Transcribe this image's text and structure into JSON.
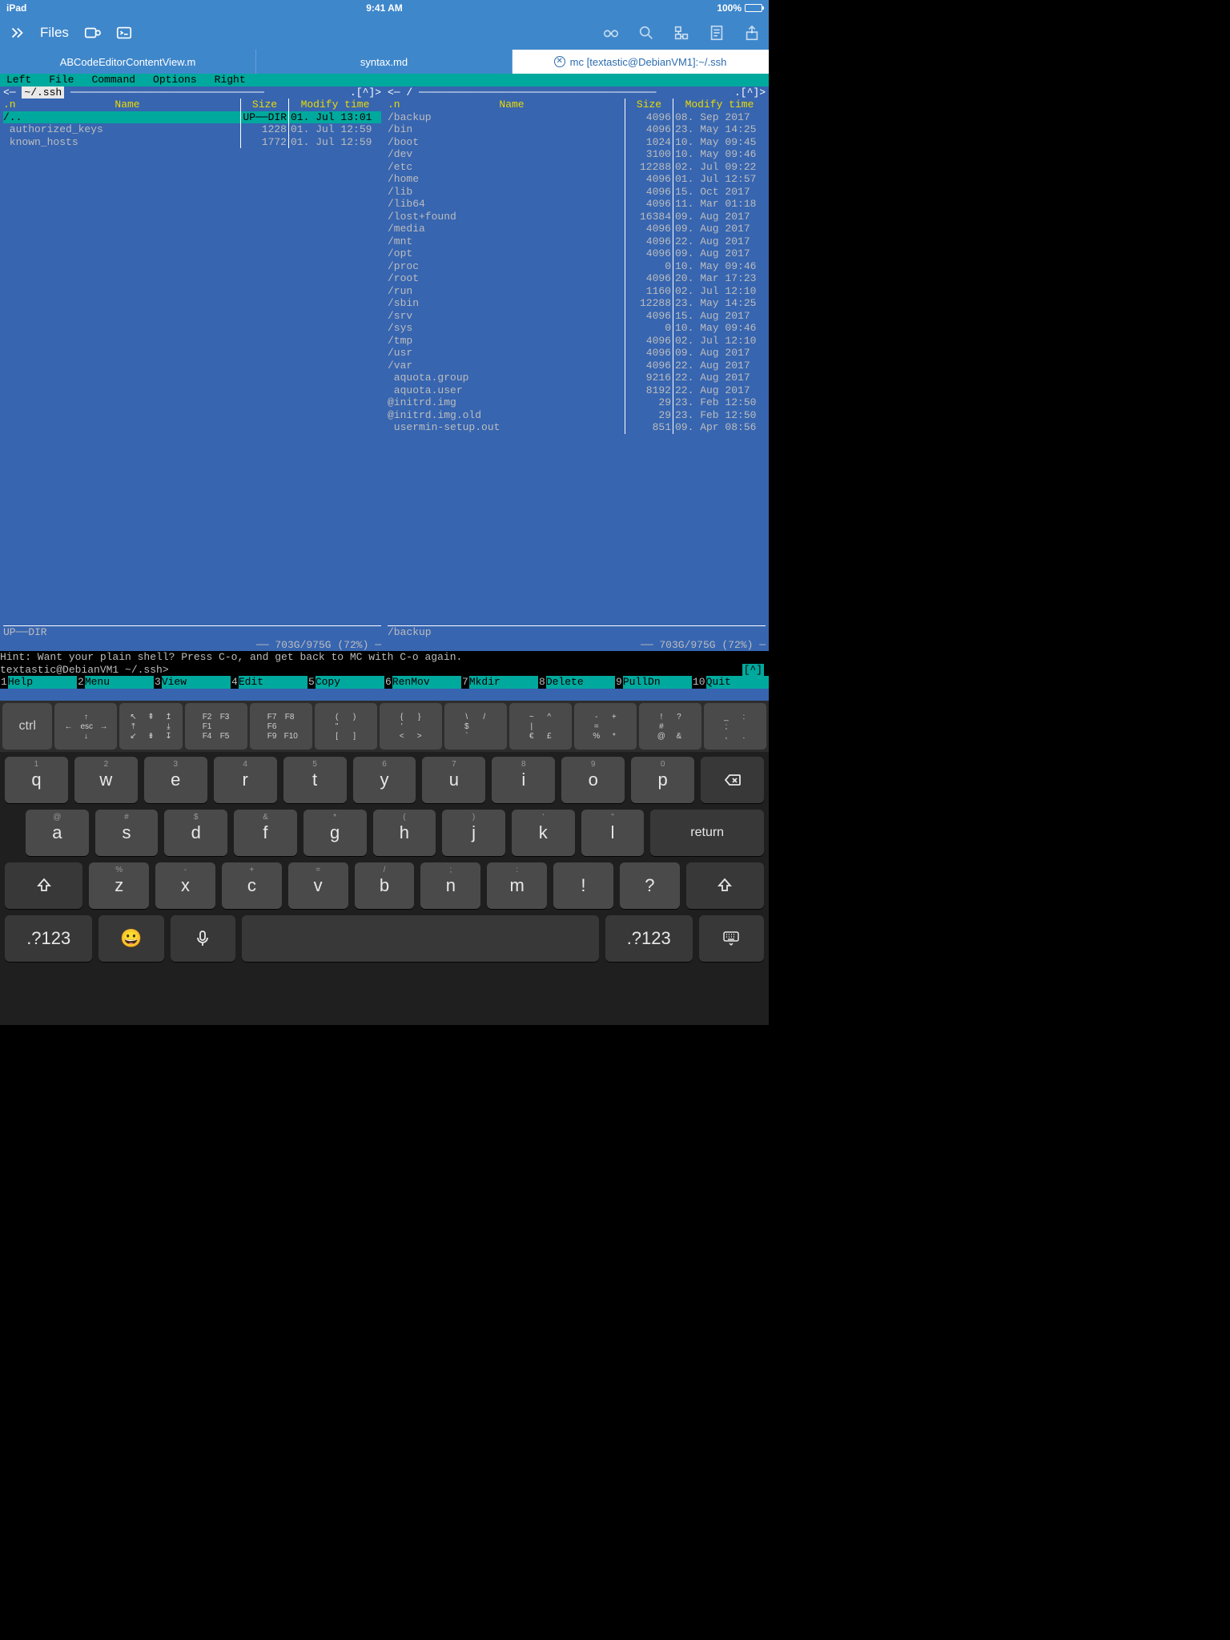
{
  "status": {
    "device": "iPad",
    "time": "9:41 AM",
    "battery": "100%"
  },
  "toolbar": {
    "title": "Files"
  },
  "tabs": [
    {
      "label": "ABCodeEditorContentView.m",
      "active": false
    },
    {
      "label": "syntax.md",
      "active": false
    },
    {
      "label": "mc [textastic@DebianVM1]:~/.ssh",
      "active": true
    }
  ],
  "mc": {
    "menu": [
      "Left",
      "File",
      "Command",
      "Options",
      "Right"
    ],
    "left": {
      "path": "~/.ssh",
      "path_prefix": "<─ ",
      "hdr_tail": " .[^]>",
      "cols": {
        "n": ".n",
        "name": "Name",
        "size": "Size",
        "mtime": "Modify time"
      },
      "rows": [
        {
          "name": "/..",
          "size": "UP──DIR",
          "mtime": "01. Jul 13:01",
          "sel": true
        },
        {
          "name": " authorized_keys",
          "size": "1228",
          "mtime": "01. Jul 12:59"
        },
        {
          "name": " known_hosts",
          "size": "1772",
          "mtime": "01. Jul 12:59"
        }
      ],
      "footer1": "UP──DIR",
      "footer2": "── 703G/975G (72%) ─"
    },
    "right": {
      "path": "/",
      "path_prefix": "<─ ",
      "hdr_tail": " .[^]>",
      "cols": {
        "n": ".n",
        "name": "Name",
        "size": "Size",
        "mtime": "Modify time"
      },
      "rows": [
        {
          "name": "/backup",
          "size": "4096",
          "mtime": "08. Sep 2017"
        },
        {
          "name": "/bin",
          "size": "4096",
          "mtime": "23. May 14:25"
        },
        {
          "name": "/boot",
          "size": "1024",
          "mtime": "10. May 09:45"
        },
        {
          "name": "/dev",
          "size": "3100",
          "mtime": "10. May 09:46"
        },
        {
          "name": "/etc",
          "size": "12288",
          "mtime": "02. Jul 09:22"
        },
        {
          "name": "/home",
          "size": "4096",
          "mtime": "01. Jul 12:57"
        },
        {
          "name": "/lib",
          "size": "4096",
          "mtime": "15. Oct 2017"
        },
        {
          "name": "/lib64",
          "size": "4096",
          "mtime": "11. Mar 01:18"
        },
        {
          "name": "/lost+found",
          "size": "16384",
          "mtime": "09. Aug 2017"
        },
        {
          "name": "/media",
          "size": "4096",
          "mtime": "09. Aug 2017"
        },
        {
          "name": "/mnt",
          "size": "4096",
          "mtime": "22. Aug 2017"
        },
        {
          "name": "/opt",
          "size": "4096",
          "mtime": "09. Aug 2017"
        },
        {
          "name": "/proc",
          "size": "0",
          "mtime": "10. May 09:46"
        },
        {
          "name": "/root",
          "size": "4096",
          "mtime": "20. Mar 17:23"
        },
        {
          "name": "/run",
          "size": "1160",
          "mtime": "02. Jul 12:10"
        },
        {
          "name": "/sbin",
          "size": "12288",
          "mtime": "23. May 14:25"
        },
        {
          "name": "/srv",
          "size": "4096",
          "mtime": "15. Aug 2017"
        },
        {
          "name": "/sys",
          "size": "0",
          "mtime": "10. May 09:46"
        },
        {
          "name": "/tmp",
          "size": "4096",
          "mtime": "02. Jul 12:10"
        },
        {
          "name": "/usr",
          "size": "4096",
          "mtime": "09. Aug 2017"
        },
        {
          "name": "/var",
          "size": "4096",
          "mtime": "22. Aug 2017"
        },
        {
          "name": " aquota.group",
          "size": "9216",
          "mtime": "22. Aug 2017"
        },
        {
          "name": " aquota.user",
          "size": "8192",
          "mtime": "22. Aug 2017"
        },
        {
          "name": "@initrd.img",
          "size": "29",
          "mtime": "23. Feb 12:50"
        },
        {
          "name": "@initrd.img.old",
          "size": "29",
          "mtime": "23. Feb 12:50"
        },
        {
          "name": " usermin-setup.out",
          "size": "851",
          "mtime": "09. Apr 08:56"
        }
      ],
      "footer1": "/backup",
      "footer2": "── 703G/975G (72%) ─"
    },
    "hint": "Hint: Want your plain shell? Press C-o, and get back to MC with C-o again.",
    "prompt": "textastic@DebianVM1 ~/.ssh>",
    "caret": "[^]",
    "fnkeys": [
      {
        "n": "1",
        "l": "Help"
      },
      {
        "n": "2",
        "l": "Menu"
      },
      {
        "n": "3",
        "l": "View"
      },
      {
        "n": "4",
        "l": "Edit"
      },
      {
        "n": "5",
        "l": "Copy"
      },
      {
        "n": "6",
        "l": "RenMov"
      },
      {
        "n": "7",
        "l": "Mkdir"
      },
      {
        "n": "8",
        "l": "Delete"
      },
      {
        "n": "9",
        "l": "PullDn"
      },
      {
        "n": "10",
        "l": "Quit"
      }
    ]
  },
  "kext": {
    "ctrl": "ctrl",
    "groups": [
      [
        [
          "",
          "↑",
          ""
        ],
        [
          "←",
          "esc",
          "→"
        ],
        [
          "",
          "↓",
          ""
        ]
      ],
      [
        [
          "↖",
          "⇞",
          "↥"
        ],
        [
          "⤒",
          "",
          "⤓"
        ],
        [
          "↙",
          "⇟",
          "↧"
        ]
      ],
      [
        [
          "F2",
          "F3"
        ],
        [
          "F1",
          ""
        ],
        [
          "F4",
          "F5"
        ]
      ],
      [
        [
          "F7",
          "F8"
        ],
        [
          "F6",
          ""
        ],
        [
          "F9",
          "F10"
        ]
      ],
      [
        [
          "(",
          ")"
        ],
        [
          "\"",
          ""
        ],
        [
          "[",
          "]"
        ]
      ],
      [
        [
          "{",
          "}"
        ],
        [
          "'",
          ""
        ],
        [
          "<",
          ">"
        ]
      ],
      [
        [
          "\\",
          "/"
        ],
        [
          "$",
          ""
        ],
        [
          "`",
          ""
        ]
      ],
      [
        [
          "~",
          "^"
        ],
        [
          "|",
          ""
        ],
        [
          "€",
          "£"
        ]
      ],
      [
        [
          "-",
          "+"
        ],
        [
          "=",
          ""
        ],
        [
          "%",
          "*"
        ]
      ],
      [
        [
          "!",
          "?"
        ],
        [
          "#",
          ""
        ],
        [
          "@",
          "&"
        ]
      ],
      [
        [
          "_",
          ":"
        ],
        [
          ";",
          ""
        ],
        [
          ",",
          "."
        ]
      ]
    ]
  },
  "keyboard": {
    "row1": [
      {
        "sub": "1",
        "main": "q"
      },
      {
        "sub": "2",
        "main": "w"
      },
      {
        "sub": "3",
        "main": "e"
      },
      {
        "sub": "4",
        "main": "r"
      },
      {
        "sub": "5",
        "main": "t"
      },
      {
        "sub": "6",
        "main": "y"
      },
      {
        "sub": "7",
        "main": "u"
      },
      {
        "sub": "8",
        "main": "i"
      },
      {
        "sub": "9",
        "main": "o"
      },
      {
        "sub": "0",
        "main": "p"
      }
    ],
    "row2": [
      {
        "sub": "@",
        "main": "a"
      },
      {
        "sub": "#",
        "main": "s"
      },
      {
        "sub": "$",
        "main": "d"
      },
      {
        "sub": "&",
        "main": "f"
      },
      {
        "sub": "*",
        "main": "g"
      },
      {
        "sub": "(",
        "main": "h"
      },
      {
        "sub": ")",
        "main": "j"
      },
      {
        "sub": "'",
        "main": "k"
      },
      {
        "sub": "\"",
        "main": "l"
      }
    ],
    "row3": [
      {
        "sub": "%",
        "main": "z"
      },
      {
        "sub": "-",
        "main": "x"
      },
      {
        "sub": "+",
        "main": "c"
      },
      {
        "sub": "=",
        "main": "v"
      },
      {
        "sub": "/",
        "main": "b"
      },
      {
        "sub": ";",
        "main": "n"
      },
      {
        "sub": ":",
        "main": "m"
      },
      {
        "sub": "",
        "main": "!"
      },
      {
        "sub": "",
        "main": "?"
      }
    ],
    "return": "return",
    "numkey": ".?123"
  }
}
